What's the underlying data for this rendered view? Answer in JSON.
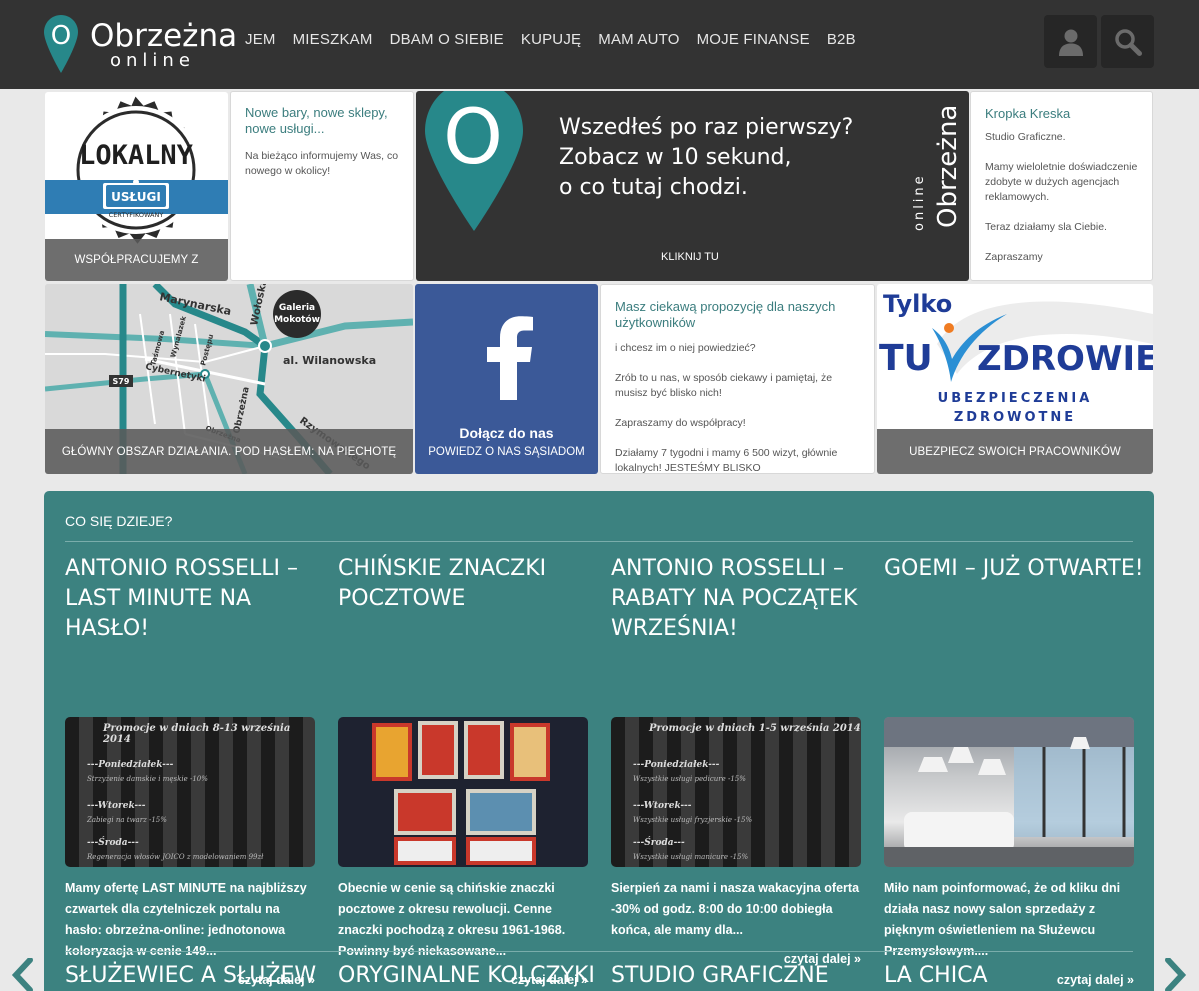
{
  "header": {
    "logo_main": "Obrzeżna",
    "logo_sub": "online",
    "nav": [
      "JEM",
      "MIESZKAM",
      "DBAM O SIEBIE",
      "KUPUJĘ",
      "MAM AUTO",
      "MOJE FINANSE",
      "B2B"
    ]
  },
  "tiles": {
    "lokalny": {
      "badge_top": "LOKALNY",
      "badge_ribbon": "USŁUGI",
      "badge_bottom": "CERTYFIKOWANY",
      "caption": "WSPÓŁPRACUJEMY Z"
    },
    "nowe": {
      "title": "Nowe bary, nowe sklepy, nowe usługi...",
      "text": "Na bieżąco informujemy Was, co nowego w okolicy!"
    },
    "intro": {
      "line1": "Wszedłeś po raz pierwszy?",
      "line2": "Zobacz w 10 sekund,",
      "line3": "o co tutaj chodzi.",
      "side_small": "online",
      "side_big": "Obrzeżna",
      "cta": "KLIKNIJ TU"
    },
    "kropka": {
      "title": "Kropka Kreska",
      "text": "Studio Graficzne.\n\nMamy wieloletnie doświadczenie zdobyte w dużych agencjach reklamowych.\n\nTeraz działamy sla Ciebie.\n\nZapraszamy"
    },
    "map": {
      "labels": [
        "Marynarska",
        "Wołoska",
        "Galeria",
        "Mokotów",
        "al. Wilanowska",
        "Taśmowa",
        "Wynalazek",
        "Postępu",
        "Cybernetyki",
        "S79",
        "Obrzeżna",
        "Rzymowskiego",
        "Obrzeżna"
      ],
      "caption": "GŁÓWNY OBSZAR DZIAŁANIA. POD HASŁEM: NA PIECHOTĘ"
    },
    "facebook": {
      "title": "Dołącz do nas",
      "subtitle": "POWIEDZ O NAS SĄSIADOM"
    },
    "propozycja": {
      "title": "Masz ciekawą propozycję dla naszych użytkowników",
      "text": "i chcesz im o niej powiedzieć?\n\nZrób to u nas, w sposób ciekawy i pamiętaj, że musisz być blisko nich!\n\nZapraszamy do współpracy!\n\nDziałamy 7 tygodni i mamy 6 500 wizyt, głównie lokalnych! JESTEŚMY BLISKO"
    },
    "zdrowie": {
      "tylko": "Tylko",
      "tu": "TU",
      "zdrowie": "ZDROWIE",
      "sub1": "UBEZPIECZENIA",
      "sub2": "ZDROWOTNE",
      "caption": "UBEZPIECZ SWOICH PRACOWNIKÓW"
    }
  },
  "section": {
    "title": "CO SIĘ DZIEJE?",
    "articles": [
      {
        "title": "ANTONIO ROSSELLI – LAST MINUTE NA HASŁO!",
        "img_heading": "Promocje w dniach  8-13 września 2014",
        "img_lines": [
          "---Poniedziałek---",
          "Strzyżenie damskie i męskie -10%",
          "---Wtorek---",
          "Zabiegi na twarz -15%",
          "---Środa---",
          "Regeneracja włosów JOICO z modelowaniem 99zł"
        ],
        "text": "Mamy ofertę LAST MINUTE  na najbliższy czwartek dla czytelniczek portalu na hasło: obrzeżna-online: jednotonowa koloryzacja w cenie 149...",
        "more": "czytaj dalej »"
      },
      {
        "title": "CHIŃSKIE ZNACZKI POCZTOWE",
        "text": "Obecnie w cenie są chińskie znaczki pocztowe z okresu rewolucji. Cenne znaczki  pochodzą z okresu 1961-1968. Powinny być niekasowane...",
        "more": "czytaj dalej »"
      },
      {
        "title": "ANTONIO ROSSELLI – RABATY NA POCZĄTEK WRZEŚNIA!",
        "img_heading": "Promocje w dniach  1-5 września 2014",
        "img_lines": [
          "---Poniedziałek---",
          "Wszystkie usługi pedicure -15%",
          "---Wtorek---",
          "Wszystkie usługi fryzjerskie -15%",
          "---Środa---",
          "Wszystkie usługi manicure -15%"
        ],
        "text": "Sierpień za nami i nasza wakacyjna oferta -30% od godz. 8:00 do 10:00 dobiegła końca, ale mamy dla...",
        "more": "czytaj dalej »"
      },
      {
        "title": "GOEMI – JUŻ OTWARTE!",
        "text": "Miło nam poinformować, że od kliku dni działa nasz nowy salon sprzedaży z pięknym oświetleniem na Służewcu Przemysłowym....",
        "more": "czytaj dalej »"
      }
    ],
    "next_titles": [
      "SŁUŻEWIEC A SŁUŻEW",
      "ORYGINALNE KOLCZYKI",
      "STUDIO GRAFICZNE",
      "LA CHICA"
    ]
  },
  "colors": {
    "header": "#333333",
    "accent": "#3c8280",
    "teal": "#27888a",
    "facebook": "#3b5998"
  },
  "icons": {
    "user": "user-icon",
    "search": "search-icon",
    "prev": "chevron-left-icon",
    "next": "chevron-right-icon",
    "facebook": "facebook-icon"
  }
}
